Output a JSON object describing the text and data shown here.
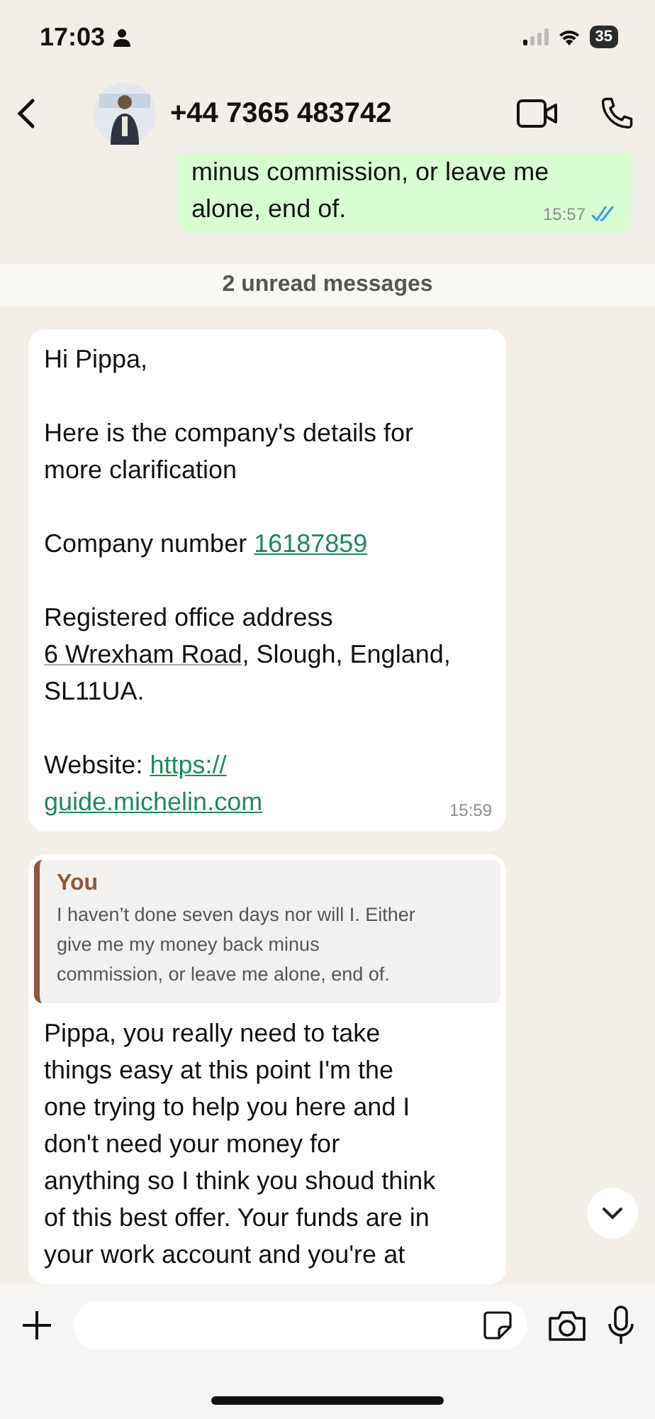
{
  "status_bar": {
    "time": "17:03",
    "battery": "35"
  },
  "header": {
    "title": "+44 7365 483742"
  },
  "sent_message": {
    "lines": [
      "minus commission, or leave me",
      "alone, end of."
    ],
    "time": "15:57",
    "read": true
  },
  "unread_banner": "2 unread messages",
  "messages": [
    {
      "paragraphs": [
        [
          [
            {
              "text": "Hi Pippa,"
            }
          ]
        ],
        [
          [
            {
              "text": "Here is the company's details for"
            }
          ],
          [
            {
              "text": "more clarification"
            }
          ]
        ],
        [
          [
            {
              "text": "Company number "
            },
            {
              "text": "16187859",
              "kind": "link"
            }
          ]
        ],
        [
          [
            {
              "text": "Registered office address"
            }
          ],
          [
            {
              "text": "6 Wrexham Road",
              "kind": "underline"
            },
            {
              "text": ", Slough, England,"
            }
          ],
          [
            {
              "text": "SL11UA."
            }
          ]
        ],
        [
          [
            {
              "text": "Website: "
            },
            {
              "text": "https://",
              "kind": "link"
            }
          ],
          [
            {
              "text": "guide.michelin.com",
              "kind": "link"
            }
          ]
        ]
      ],
      "time": "15:59"
    },
    {
      "quote": {
        "author": "You",
        "lines": [
          "I haven’t done seven days nor will I. Either",
          "give me my money back minus",
          "commission, or leave me alone, end of."
        ]
      },
      "paragraphs": [
        [
          [
            {
              "text": "Pippa, you really need to take"
            }
          ],
          [
            {
              "text": "things easy at this point I'm the"
            }
          ],
          [
            {
              "text": "one trying to help you here and I"
            }
          ],
          [
            {
              "text": "don't need your money for"
            }
          ],
          [
            {
              "text": "anything so I think you shoud think"
            }
          ],
          [
            {
              "text": "of this best offer. Your funds are in"
            }
          ],
          [
            {
              "text": "your work account and you're at"
            }
          ]
        ]
      ]
    }
  ]
}
